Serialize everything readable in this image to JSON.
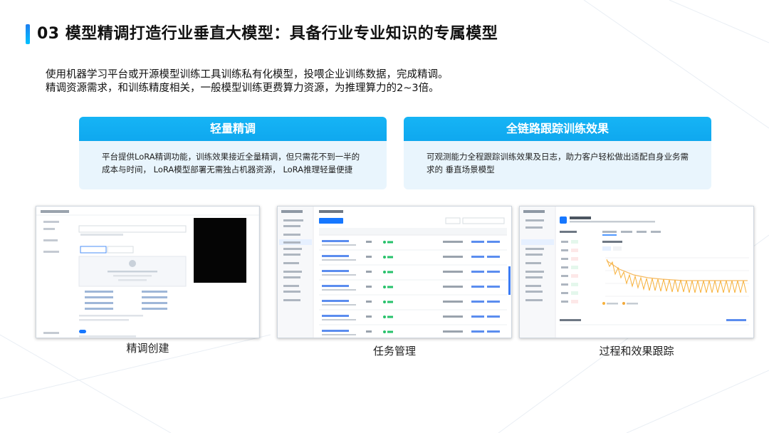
{
  "slide": {
    "title": "03 模型精调打造行业垂直大模型：具备行业专业知识的专属模型",
    "intro_line1": "使用机器学习平台或开源模型训练工具训练私有化模型，投喂企业训练数据，完成精调。",
    "intro_line2": "精调资源需求，和训练精度相关，一般模型训练更费算力资源，为推理算力的2~3倍。"
  },
  "cards": [
    {
      "title": "轻量精调",
      "line1": "平台提供LoRA精调功能，训练效果接近全量精调，但只需花不到一半的",
      "line2": "成本与时间， LoRA模型部署无需独占机器资源，  LoRA推理轻量便捷"
    },
    {
      "title": "全链路跟踪训练效果",
      "line1": "可观测能力全程跟踪训练效果及日志，助力客户轻松做出适配自身业务需",
      "line2": "求的 垂直场景模型"
    }
  ],
  "screenshots": [
    {
      "caption": "精调创建",
      "icon": "form-screenshot"
    },
    {
      "caption": "任务管理",
      "icon": "table-screenshot"
    },
    {
      "caption": "过程和效果跟踪",
      "icon": "chart-screenshot"
    }
  ],
  "colors": {
    "accent": "#16b4f5",
    "card_bg": "#e9f5fd",
    "title_bar": "#1f7ff0"
  }
}
